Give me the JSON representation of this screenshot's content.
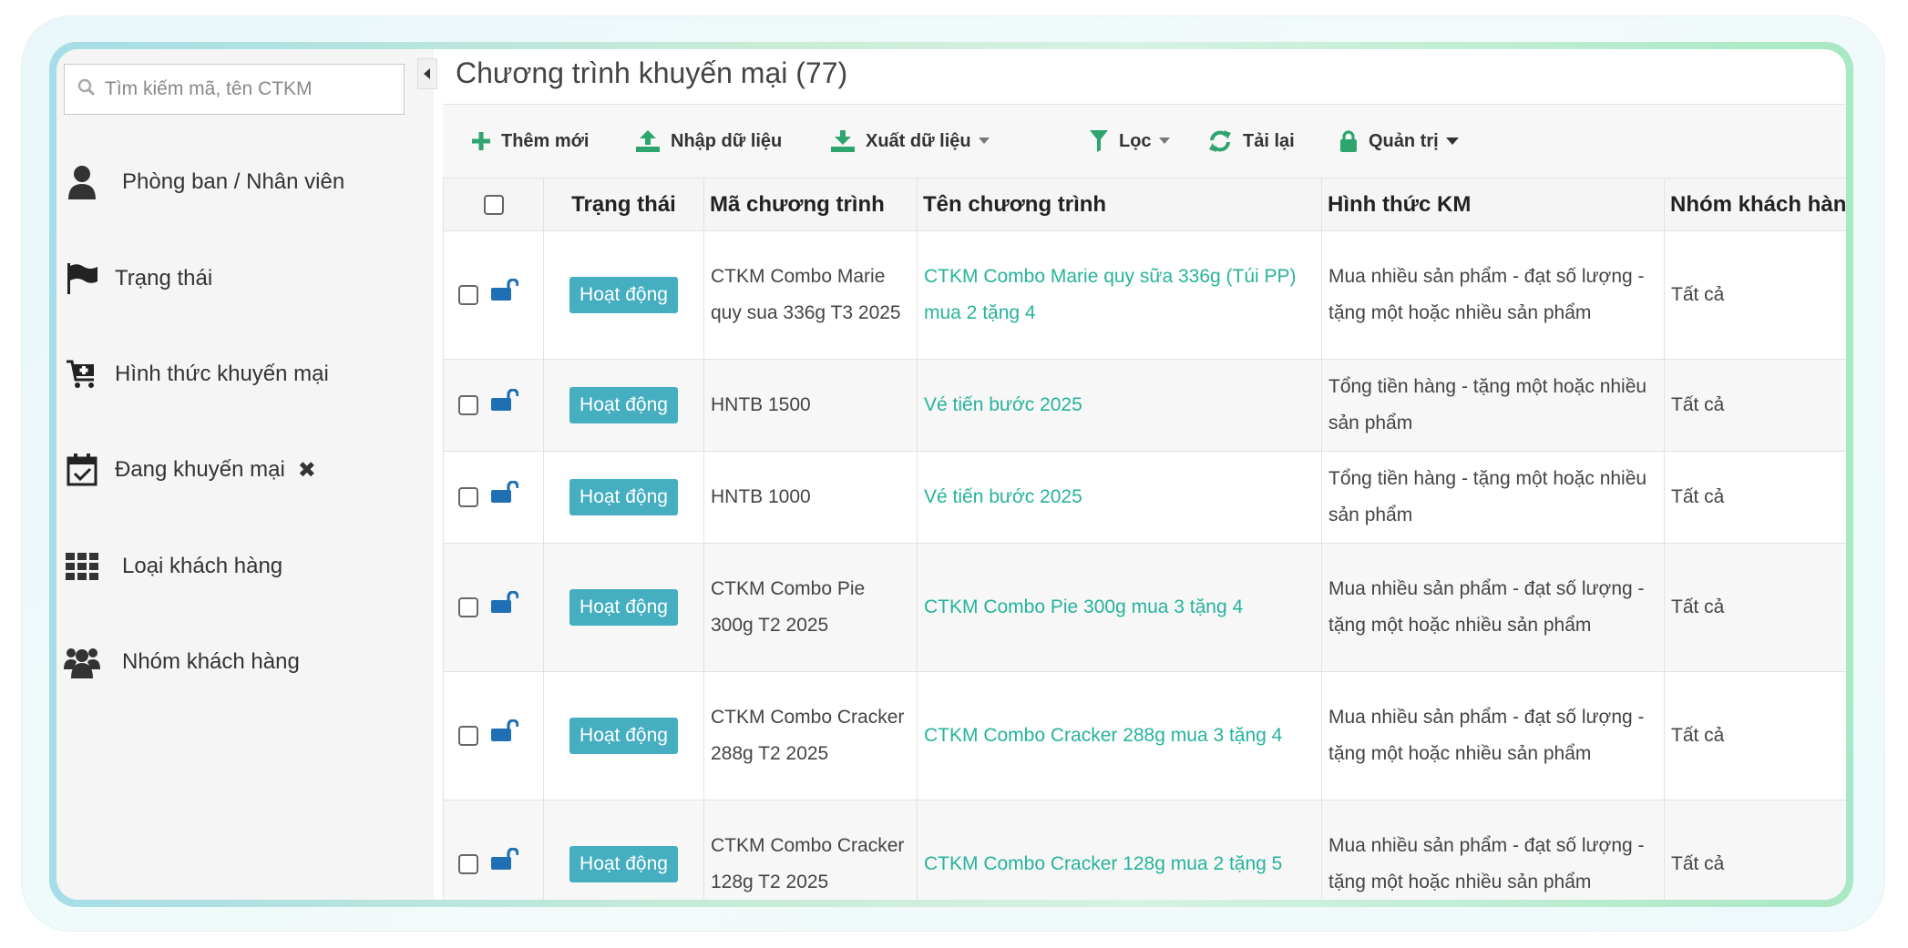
{
  "search": {
    "placeholder": "Tìm kiếm mã, tên CTKM"
  },
  "sidebar": {
    "items": [
      {
        "label": "Phòng ban / Nhân viên",
        "icon": "user-icon"
      },
      {
        "label": "Trạng thái",
        "icon": "flag-icon"
      },
      {
        "label": "Hình thức khuyến mại",
        "icon": "cart-plus-icon"
      },
      {
        "label": "Đang khuyến mại",
        "icon": "calendar-check-icon",
        "clear": "✖"
      },
      {
        "label": "Loại khách hàng",
        "icon": "grid-icon"
      },
      {
        "label": "Nhóm khách hàng",
        "icon": "users-icon"
      }
    ]
  },
  "header": {
    "title": "Chương trình khuyến mại (77)"
  },
  "toolbar": {
    "add": "Thêm mới",
    "import": "Nhập dữ liệu",
    "export": "Xuất dữ liệu",
    "filter": "Lọc",
    "reload": "Tải lại",
    "admin": "Quản trị"
  },
  "table": {
    "columns": [
      "Trạng thái",
      "Mã chương trình",
      "Tên chương trình",
      "Hình thức KM",
      "Nhóm khách hàng"
    ],
    "rows": [
      {
        "status": "Hoạt động",
        "code": "CTKM Combo Marie quy sua 336g T3 2025",
        "name": "CTKM Combo Marie quy sữa 336g (Túi PP) mua 2 tặng 4",
        "type": "Mua nhiều sản phẩm - đạt số lượng - tặng một hoặc nhiều sản phẩm",
        "group": "Tất cả"
      },
      {
        "status": "Hoạt động",
        "code": "HNTB 1500",
        "name": "Vé tiến bước 2025",
        "type": "Tổng tiền hàng - tặng một hoặc nhiều sản phẩm",
        "group": "Tất cả"
      },
      {
        "status": "Hoạt động",
        "code": "HNTB 1000",
        "name": "Vé tiến bước 2025",
        "type": "Tổng tiền hàng - tặng một hoặc nhiều sản phẩm",
        "group": "Tất cả"
      },
      {
        "status": "Hoạt động",
        "code": "CTKM Combo Pie 300g T2 2025",
        "name": "CTKM Combo Pie 300g mua 3 tặng 4",
        "type": "Mua nhiều sản phẩm - đạt số lượng - tặng một hoặc nhiều sản phẩm",
        "group": "Tất cả"
      },
      {
        "status": "Hoạt động",
        "code": "CTKM Combo Cracker 288g T2 2025",
        "name": "CTKM Combo Cracker 288g mua 3 tặng 4",
        "type": "Mua nhiều sản phẩm - đạt số lượng - tặng một hoặc nhiều sản phẩm",
        "group": "Tất cả"
      },
      {
        "status": "Hoạt động",
        "code": "CTKM Combo Cracker 128g T2 2025",
        "name": "CTKM Combo Cracker 128g mua 2 tặng 5",
        "type": "Mua nhiều sản phẩm - đạt số lượng - tặng một hoặc nhiều sản phẩm",
        "group": "Tất cả"
      }
    ]
  },
  "colors": {
    "accent": "#45aec1",
    "link": "#26b39c",
    "toolbar_icon": "#2ea56f"
  }
}
